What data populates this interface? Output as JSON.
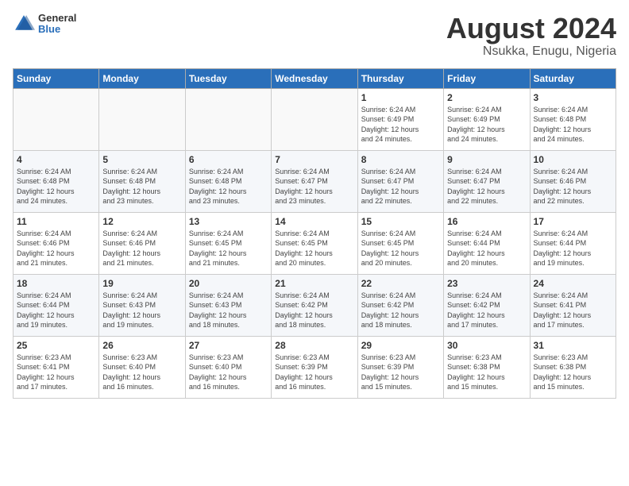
{
  "header": {
    "logo": {
      "general": "General",
      "blue": "Blue"
    },
    "title": "August 2024",
    "subtitle": "Nsukka, Enugu, Nigeria"
  },
  "weekdays": [
    "Sunday",
    "Monday",
    "Tuesday",
    "Wednesday",
    "Thursday",
    "Friday",
    "Saturday"
  ],
  "weeks": [
    [
      {
        "day": "",
        "info": ""
      },
      {
        "day": "",
        "info": ""
      },
      {
        "day": "",
        "info": ""
      },
      {
        "day": "",
        "info": ""
      },
      {
        "day": "1",
        "info": "Sunrise: 6:24 AM\nSunset: 6:49 PM\nDaylight: 12 hours\nand 24 minutes."
      },
      {
        "day": "2",
        "info": "Sunrise: 6:24 AM\nSunset: 6:49 PM\nDaylight: 12 hours\nand 24 minutes."
      },
      {
        "day": "3",
        "info": "Sunrise: 6:24 AM\nSunset: 6:48 PM\nDaylight: 12 hours\nand 24 minutes."
      }
    ],
    [
      {
        "day": "4",
        "info": "Sunrise: 6:24 AM\nSunset: 6:48 PM\nDaylight: 12 hours\nand 24 minutes."
      },
      {
        "day": "5",
        "info": "Sunrise: 6:24 AM\nSunset: 6:48 PM\nDaylight: 12 hours\nand 23 minutes."
      },
      {
        "day": "6",
        "info": "Sunrise: 6:24 AM\nSunset: 6:48 PM\nDaylight: 12 hours\nand 23 minutes."
      },
      {
        "day": "7",
        "info": "Sunrise: 6:24 AM\nSunset: 6:47 PM\nDaylight: 12 hours\nand 23 minutes."
      },
      {
        "day": "8",
        "info": "Sunrise: 6:24 AM\nSunset: 6:47 PM\nDaylight: 12 hours\nand 22 minutes."
      },
      {
        "day": "9",
        "info": "Sunrise: 6:24 AM\nSunset: 6:47 PM\nDaylight: 12 hours\nand 22 minutes."
      },
      {
        "day": "10",
        "info": "Sunrise: 6:24 AM\nSunset: 6:46 PM\nDaylight: 12 hours\nand 22 minutes."
      }
    ],
    [
      {
        "day": "11",
        "info": "Sunrise: 6:24 AM\nSunset: 6:46 PM\nDaylight: 12 hours\nand 21 minutes."
      },
      {
        "day": "12",
        "info": "Sunrise: 6:24 AM\nSunset: 6:46 PM\nDaylight: 12 hours\nand 21 minutes."
      },
      {
        "day": "13",
        "info": "Sunrise: 6:24 AM\nSunset: 6:45 PM\nDaylight: 12 hours\nand 21 minutes."
      },
      {
        "day": "14",
        "info": "Sunrise: 6:24 AM\nSunset: 6:45 PM\nDaylight: 12 hours\nand 20 minutes."
      },
      {
        "day": "15",
        "info": "Sunrise: 6:24 AM\nSunset: 6:45 PM\nDaylight: 12 hours\nand 20 minutes."
      },
      {
        "day": "16",
        "info": "Sunrise: 6:24 AM\nSunset: 6:44 PM\nDaylight: 12 hours\nand 20 minutes."
      },
      {
        "day": "17",
        "info": "Sunrise: 6:24 AM\nSunset: 6:44 PM\nDaylight: 12 hours\nand 19 minutes."
      }
    ],
    [
      {
        "day": "18",
        "info": "Sunrise: 6:24 AM\nSunset: 6:44 PM\nDaylight: 12 hours\nand 19 minutes."
      },
      {
        "day": "19",
        "info": "Sunrise: 6:24 AM\nSunset: 6:43 PM\nDaylight: 12 hours\nand 19 minutes."
      },
      {
        "day": "20",
        "info": "Sunrise: 6:24 AM\nSunset: 6:43 PM\nDaylight: 12 hours\nand 18 minutes."
      },
      {
        "day": "21",
        "info": "Sunrise: 6:24 AM\nSunset: 6:42 PM\nDaylight: 12 hours\nand 18 minutes."
      },
      {
        "day": "22",
        "info": "Sunrise: 6:24 AM\nSunset: 6:42 PM\nDaylight: 12 hours\nand 18 minutes."
      },
      {
        "day": "23",
        "info": "Sunrise: 6:24 AM\nSunset: 6:42 PM\nDaylight: 12 hours\nand 17 minutes."
      },
      {
        "day": "24",
        "info": "Sunrise: 6:24 AM\nSunset: 6:41 PM\nDaylight: 12 hours\nand 17 minutes."
      }
    ],
    [
      {
        "day": "25",
        "info": "Sunrise: 6:23 AM\nSunset: 6:41 PM\nDaylight: 12 hours\nand 17 minutes."
      },
      {
        "day": "26",
        "info": "Sunrise: 6:23 AM\nSunset: 6:40 PM\nDaylight: 12 hours\nand 16 minutes."
      },
      {
        "day": "27",
        "info": "Sunrise: 6:23 AM\nSunset: 6:40 PM\nDaylight: 12 hours\nand 16 minutes."
      },
      {
        "day": "28",
        "info": "Sunrise: 6:23 AM\nSunset: 6:39 PM\nDaylight: 12 hours\nand 16 minutes."
      },
      {
        "day": "29",
        "info": "Sunrise: 6:23 AM\nSunset: 6:39 PM\nDaylight: 12 hours\nand 15 minutes."
      },
      {
        "day": "30",
        "info": "Sunrise: 6:23 AM\nSunset: 6:38 PM\nDaylight: 12 hours\nand 15 minutes."
      },
      {
        "day": "31",
        "info": "Sunrise: 6:23 AM\nSunset: 6:38 PM\nDaylight: 12 hours\nand 15 minutes."
      }
    ]
  ]
}
